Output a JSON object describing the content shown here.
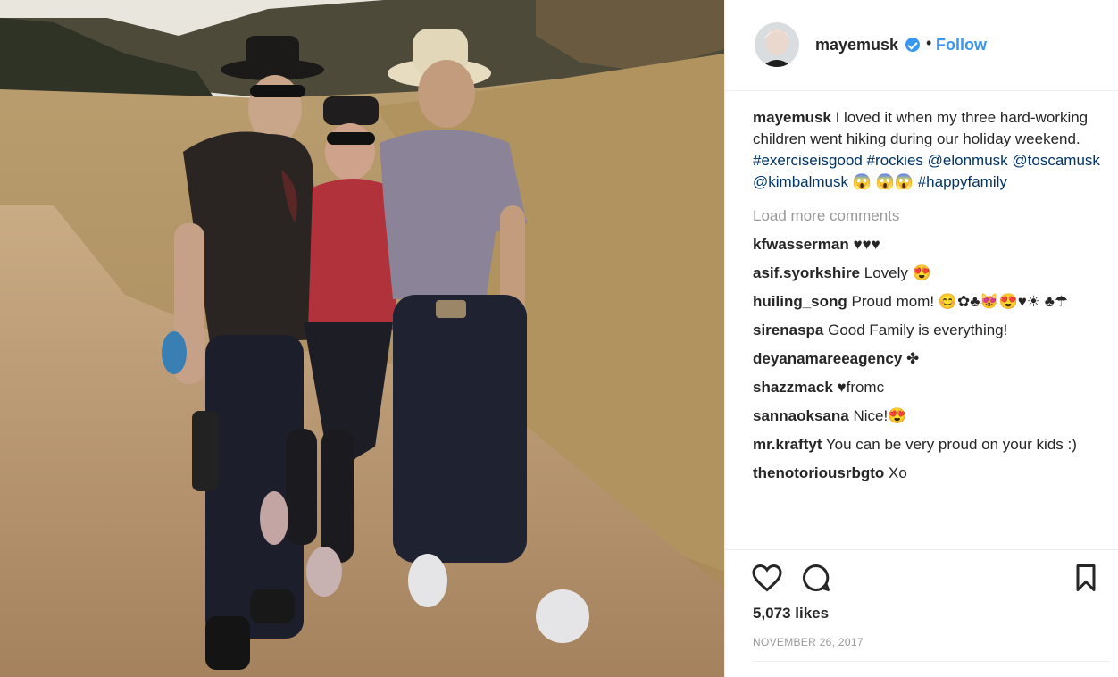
{
  "post": {
    "username": "mayemusk",
    "follow_label": "Follow",
    "separator": "•",
    "caption_user": "mayemusk",
    "caption_text": " I loved it when my three hard-working children went hiking during our holiday weekend. ",
    "caption_tags": [
      "#exerciseisgood",
      "#rockies",
      "@elonmusk",
      "@toscamusk",
      "@kimbalmusk"
    ],
    "caption_tail_emoji": "😱",
    "caption_tail_emoji2": "😱😱",
    "caption_tag_last": "#happyfamily",
    "load_more": "Load more comments",
    "likes": "5,073 likes",
    "date": "NOVEMBER 26, 2017"
  },
  "comments": [
    {
      "user": "kfwasserman",
      "text": " ♥♥♥"
    },
    {
      "user": "asif.syorkshire",
      "text": " Lovely 😍"
    },
    {
      "user": "huiling_song",
      "text": " Proud mom! 😊✿♣😻😍♥☀ ♣☂"
    },
    {
      "user": "sirenaspa",
      "text": " Good Family is everything!"
    },
    {
      "user": "deyanamareeagency",
      "text": " ✤"
    },
    {
      "user": "shazzmack",
      "text": " ♥fromc"
    },
    {
      "user": "sannaoksana",
      "text": " Nice!😍"
    },
    {
      "user": "mr.kraftyt",
      "text": " You can be very proud on your kids :)"
    },
    {
      "user": "thenotoriousrbgto",
      "text": " Xo"
    }
  ],
  "icons": {
    "like": "heart-icon",
    "comment": "comment-icon",
    "save": "bookmark-icon",
    "verified": "verified-badge-icon"
  },
  "colors": {
    "accent": "#3897f0",
    "tag": "#003569",
    "muted": "#999999",
    "text": "#262626"
  }
}
